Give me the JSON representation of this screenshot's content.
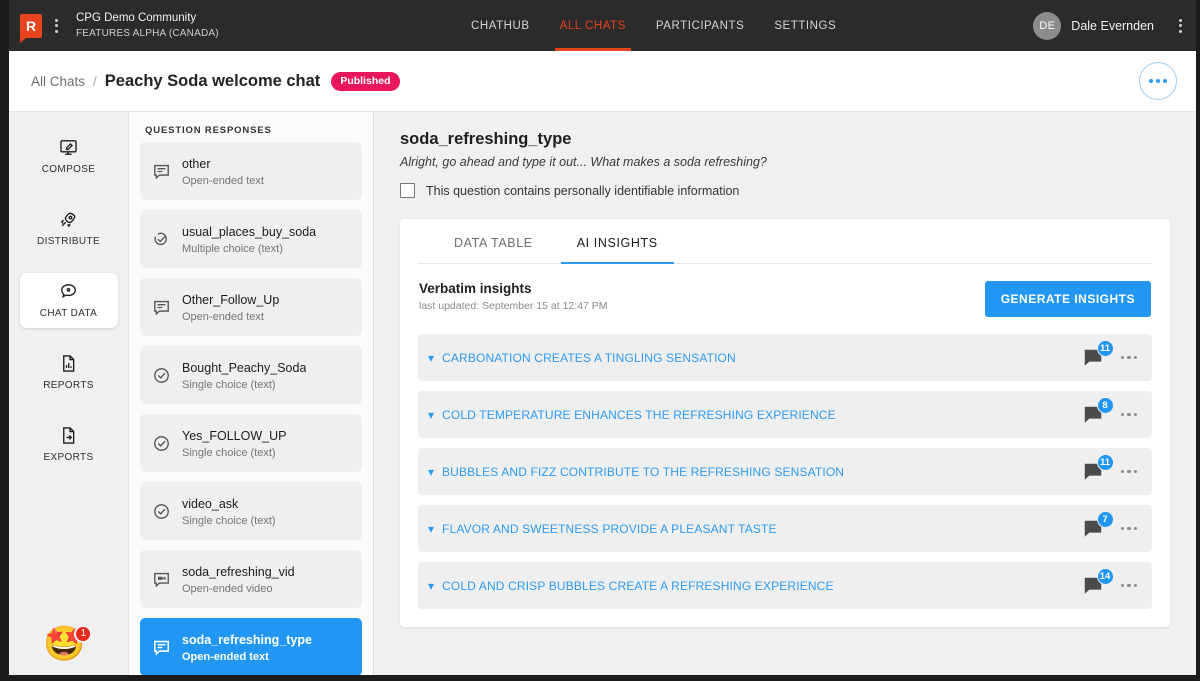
{
  "topbar": {
    "logo_letter": "R",
    "community_name": "CPG Demo Community",
    "community_sub": "FEATURES ALPHA (CANADA)",
    "nav": [
      {
        "label": "CHATHUB",
        "active": false
      },
      {
        "label": "ALL CHATS",
        "active": true
      },
      {
        "label": "PARTICIPANTS",
        "active": false
      },
      {
        "label": "SETTINGS",
        "active": false
      }
    ],
    "user": {
      "initials": "DE",
      "name": "Dale Evernden"
    },
    "accent_color": "#e8431f"
  },
  "breadcrumb": {
    "root": "All Chats",
    "separator": "/",
    "title": "Peachy Soda welcome chat",
    "status_badge": "Published",
    "badge_color": "#e8175d"
  },
  "rail": {
    "items": [
      {
        "label": "COMPOSE",
        "icon": "compose-monitor-icon",
        "active": false
      },
      {
        "label": "DISTRIBUTE",
        "icon": "rocket-icon",
        "active": false
      },
      {
        "label": "CHAT DATA",
        "icon": "chat-bubble-icon",
        "active": true
      },
      {
        "label": "REPORTS",
        "icon": "report-chart-icon",
        "active": false
      },
      {
        "label": "EXPORTS",
        "icon": "export-file-icon",
        "active": false
      }
    ],
    "emoji": {
      "glyph": "🤩",
      "badge_count": "1",
      "badge_color": "#e8291c"
    }
  },
  "question_panel": {
    "header": "QUESTION RESPONSES",
    "items": [
      {
        "name": "other",
        "type": "Open-ended text",
        "icon": "text-bubble-icon",
        "selected": false
      },
      {
        "name": "usual_places_buy_soda",
        "type": "Multiple choice (text)",
        "icon": "multi-check-icon",
        "selected": false
      },
      {
        "name": "Other_Follow_Up",
        "type": "Open-ended text",
        "icon": "text-bubble-icon",
        "selected": false
      },
      {
        "name": "Bought_Peachy_Soda",
        "type": "Single choice (text)",
        "icon": "check-circle-icon",
        "selected": false
      },
      {
        "name": "Yes_FOLLOW_UP",
        "type": "Single choice (text)",
        "icon": "check-circle-icon",
        "selected": false
      },
      {
        "name": "video_ask",
        "type": "Single choice (text)",
        "icon": "check-circle-icon",
        "selected": false
      },
      {
        "name": "soda_refreshing_vid",
        "type": "Open-ended video",
        "icon": "video-bubble-icon",
        "selected": false
      },
      {
        "name": "soda_refreshing_type",
        "type": "Open-ended text",
        "icon": "text-bubble-icon",
        "selected": true
      }
    ],
    "selected_color": "#2196f3"
  },
  "main": {
    "question_title": "soda_refreshing_type",
    "question_prompt": "Alright, go ahead and type it out... What makes a soda refreshing?",
    "pii_label": "This question contains personally identifiable information",
    "pii_checked": false,
    "tabs": [
      {
        "label": "DATA TABLE",
        "active": false
      },
      {
        "label": "AI INSIGHTS",
        "active": true
      }
    ],
    "insights_title": "Verbatim insights",
    "insights_updated": "last updated: September 15 at 12:47 PM",
    "generate_button": "GENERATE INSIGHTS",
    "tab_accent": "#2e9bf0",
    "insights": [
      {
        "text": "CARBONATION CREATES A TINGLING SENSATION",
        "count": "11"
      },
      {
        "text": "COLD TEMPERATURE ENHANCES THE REFRESHING EXPERIENCE",
        "count": "8"
      },
      {
        "text": "BUBBLES AND FIZZ CONTRIBUTE TO THE REFRESHING SENSATION",
        "count": "11"
      },
      {
        "text": "FLAVOR AND SWEETNESS PROVIDE A PLEASANT TASTE",
        "count": "7"
      },
      {
        "text": "COLD AND CRISP BUBBLES CREATE A REFRESHING EXPERIENCE",
        "count": "14"
      }
    ]
  }
}
